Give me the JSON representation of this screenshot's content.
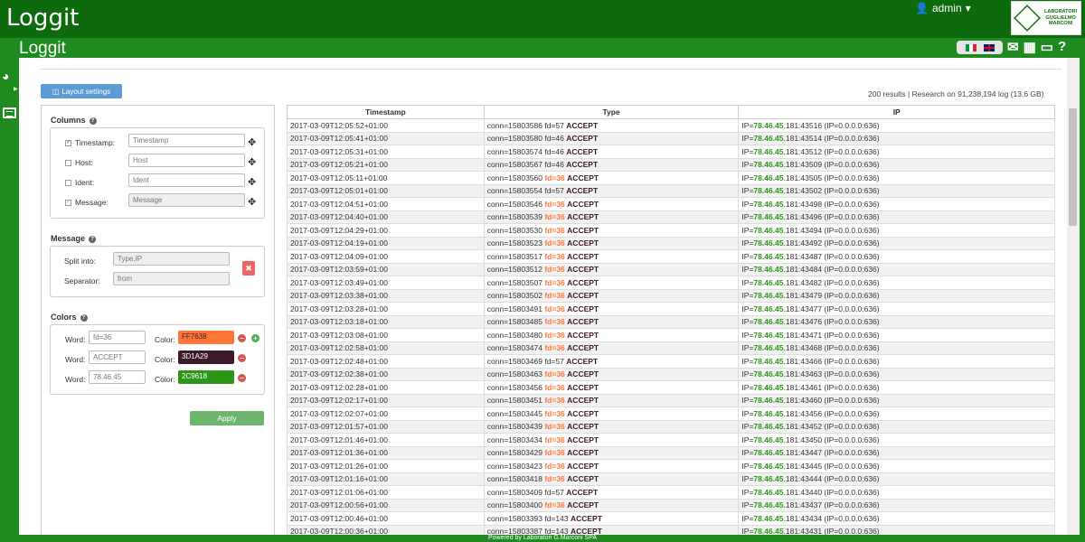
{
  "app": {
    "brand": "Loggit",
    "subtitle": "Loggit",
    "user": "admin",
    "footer": "Powered by Laboratori G.Marconi SPA"
  },
  "logo": {
    "line1": "LABORATORI",
    "line2": "GUGLIELMO",
    "line3": "MARCONI"
  },
  "layout_button": "Layout settings",
  "results": "200 results | Research on 91,238,194 log (13.6 GB)",
  "columns_section": {
    "title": "Columns",
    "items": [
      {
        "label": "Timestamp:",
        "value": "Timestamp",
        "checked": true
      },
      {
        "label": "Host:",
        "value": "Host",
        "checked": false
      },
      {
        "label": "Ident:",
        "value": "Ident",
        "checked": false
      },
      {
        "label": "Message:",
        "value": "Message",
        "checked": true
      }
    ]
  },
  "message_section": {
    "title": "Message",
    "split_label": "Split into:",
    "split_value": "Type,IP",
    "separator_label": "Separator:",
    "separator_value": "from"
  },
  "colors_section": {
    "title": "Colors",
    "word_label": "Word:",
    "color_label": "Color:",
    "items": [
      {
        "word": "fd=36",
        "color": "FF7638",
        "hex": "#FF7638",
        "text": "#3d1a29"
      },
      {
        "word": "ACCEPT",
        "color": "3D1A29",
        "hex": "#3D1A29",
        "text": "#ffffff"
      },
      {
        "word": "78.46.45",
        "color": "2C9618",
        "hex": "#2C9618",
        "text": "#ffffff"
      }
    ]
  },
  "apply_button": "Apply",
  "table": {
    "headers": [
      "Timestamp",
      "Type",
      "IP"
    ],
    "rows": [
      [
        "2017-03-09T12:05:52+01:00",
        "conn=15803586 fd=57 ACCEPT",
        "IP=78.46.45.181:43516 (IP=0.0.0.0:636)"
      ],
      [
        "2017-03-09T12:05:41+01:00",
        "conn=15803580 fd=46 ACCEPT",
        "IP=78.46.45.181:43514 (IP=0.0.0.0:636)"
      ],
      [
        "2017-03-09T12:05:31+01:00",
        "conn=15803574 fd=46 ACCEPT",
        "IP=78.46.45.181:43512 (IP=0.0.0.0:636)"
      ],
      [
        "2017-03-09T12:05:21+01:00",
        "conn=15803567 fd=46 ACCEPT",
        "IP=78.46.45.181:43509 (IP=0.0.0.0:636)"
      ],
      [
        "2017-03-09T12:05:11+01:00",
        "conn=15803560 fd=36 ACCEPT",
        "IP=78.46.45.181:43505 (IP=0.0.0.0:636)"
      ],
      [
        "2017-03-09T12:05:01+01:00",
        "conn=15803554 fd=57 ACCEPT",
        "IP=78.46.45.181:43502 (IP=0.0.0.0:636)"
      ],
      [
        "2017-03-09T12:04:51+01:00",
        "conn=15803546 fd=36 ACCEPT",
        "IP=78.46.45.181:43498 (IP=0.0.0.0:636)"
      ],
      [
        "2017-03-09T12:04:40+01:00",
        "conn=15803539 fd=36 ACCEPT",
        "IP=78.46.45.181:43496 (IP=0.0.0.0:636)"
      ],
      [
        "2017-03-09T12:04:29+01:00",
        "conn=15803530 fd=36 ACCEPT",
        "IP=78.46.45.181:43494 (IP=0.0.0.0:636)"
      ],
      [
        "2017-03-09T12:04:19+01:00",
        "conn=15803523 fd=36 ACCEPT",
        "IP=78.46.45.181:43492 (IP=0.0.0.0:636)"
      ],
      [
        "2017-03-09T12:04:09+01:00",
        "conn=15803517 fd=36 ACCEPT",
        "IP=78.46.45.181:43487 (IP=0.0.0.0:636)"
      ],
      [
        "2017-03-09T12:03:59+01:00",
        "conn=15803512 fd=36 ACCEPT",
        "IP=78.46.45.181:43484 (IP=0.0.0.0:636)"
      ],
      [
        "2017-03-09T12:03:49+01:00",
        "conn=15803507 fd=36 ACCEPT",
        "IP=78.46.45.181:43482 (IP=0.0.0.0:636)"
      ],
      [
        "2017-03-09T12:03:38+01:00",
        "conn=15803502 fd=36 ACCEPT",
        "IP=78.46.45.181:43479 (IP=0.0.0.0:636)"
      ],
      [
        "2017-03-09T12:03:28+01:00",
        "conn=15803491 fd=36 ACCEPT",
        "IP=78.46.45.181:43477 (IP=0.0.0.0:636)"
      ],
      [
        "2017-03-09T12:03:18+01:00",
        "conn=15803485 fd=36 ACCEPT",
        "IP=78.46.45.181:43476 (IP=0.0.0.0:636)"
      ],
      [
        "2017-03-09T12:03:08+01:00",
        "conn=15803480 fd=36 ACCEPT",
        "IP=78.46.45.181:43471 (IP=0.0.0.0:636)"
      ],
      [
        "2017-03-09T12:02:58+01:00",
        "conn=15803474 fd=36 ACCEPT",
        "IP=78.46.45.181:43468 (IP=0.0.0.0:636)"
      ],
      [
        "2017-03-09T12:02:48+01:00",
        "conn=15803469 fd=57 ACCEPT",
        "IP=78.46.45.181:43466 (IP=0.0.0.0:636)"
      ],
      [
        "2017-03-09T12:02:38+01:00",
        "conn=15803463 fd=36 ACCEPT",
        "IP=78.46.45.181:43463 (IP=0.0.0.0:636)"
      ],
      [
        "2017-03-09T12:02:28+01:00",
        "conn=15803456 fd=36 ACCEPT",
        "IP=78.46.45.181:43461 (IP=0.0.0.0:636)"
      ],
      [
        "2017-03-09T12:02:17+01:00",
        "conn=15803451 fd=36 ACCEPT",
        "IP=78.46.45.181:43460 (IP=0.0.0.0:636)"
      ],
      [
        "2017-03-09T12:02:07+01:00",
        "conn=15803445 fd=36 ACCEPT",
        "IP=78.46.45.181:43456 (IP=0.0.0.0:636)"
      ],
      [
        "2017-03-09T12:01:57+01:00",
        "conn=15803439 fd=36 ACCEPT",
        "IP=78.46.45.181:43452 (IP=0.0.0.0:636)"
      ],
      [
        "2017-03-09T12:01:46+01:00",
        "conn=15803434 fd=36 ACCEPT",
        "IP=78.46.45.181:43450 (IP=0.0.0.0:636)"
      ],
      [
        "2017-03-09T12:01:36+01:00",
        "conn=15803429 fd=36 ACCEPT",
        "IP=78.46.45.181:43447 (IP=0.0.0.0:636)"
      ],
      [
        "2017-03-09T12:01:26+01:00",
        "conn=15803423 fd=36 ACCEPT",
        "IP=78.46.45.181:43445 (IP=0.0.0.0:636)"
      ],
      [
        "2017-03-09T12:01:16+01:00",
        "conn=15803418 fd=36 ACCEPT",
        "IP=78.46.45.181:43444 (IP=0.0.0.0:636)"
      ],
      [
        "2017-03-09T12:01:06+01:00",
        "conn=15803409 fd=57 ACCEPT",
        "IP=78.46.45.181:43440 (IP=0.0.0.0:636)"
      ],
      [
        "2017-03-09T12:00:56+01:00",
        "conn=15803400 fd=36 ACCEPT",
        "IP=78.46.45.181:43437 (IP=0.0.0.0:636)"
      ],
      [
        "2017-03-09T12:00:46+01:00",
        "conn=15803393 fd=143 ACCEPT",
        "IP=78.46.45.181:43434 (IP=0.0.0.0:636)"
      ],
      [
        "2017-03-09T12:00:36+01:00",
        "conn=15803387 fd=143 ACCEPT",
        "IP=78.46.45.181:43431 (IP=0.0.0.0:636)"
      ]
    ]
  }
}
